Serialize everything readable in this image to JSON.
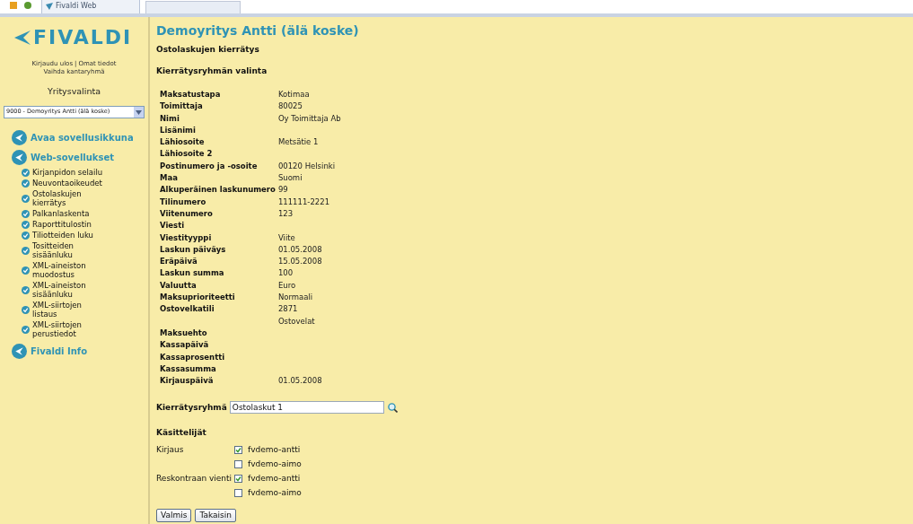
{
  "browser_tab": {
    "title": "Fivaldi Web"
  },
  "sidebar": {
    "logo": "FIVALDI",
    "links": [
      "Kirjaudu ulos",
      "Omat tiedot",
      "Vaihda kantaryhmä"
    ],
    "link_separator": "|",
    "company_label": "Yritysvalinta",
    "company_select": "9000 - Demoyritys Antti (älä koske)",
    "nav": [
      {
        "label": "Avaa sovellusikkuna"
      },
      {
        "label": "Web-sovellukset",
        "children": [
          "Kirjanpidon selailu",
          "Neuvontaoikeudet",
          "Ostolaskujen kierrätys",
          "Palkanlaskenta",
          "Raporttitulostin",
          "Tiliotteiden luku",
          "Tositteiden sisäänluku",
          "XML-aineiston muodostus",
          "XML-aineiston sisäänluku",
          "XML-siirtojen listaus",
          "XML-siirtojen perustiedot"
        ]
      },
      {
        "label": "Fivaldi Info"
      }
    ]
  },
  "main": {
    "title": "Demoyritys Antti (älä koske)",
    "subtitle": "Ostolaskujen kierrätys",
    "section": "Kierrätysryhmän valinta",
    "fields": [
      {
        "label": "Maksatustapa",
        "value": "Kotimaa"
      },
      {
        "label": "Toimittaja",
        "value": "80025"
      },
      {
        "label": "Nimi",
        "value": "Oy Toimittaja Ab"
      },
      {
        "label": "Lisänimi"
      },
      {
        "label": "Lähiosoite",
        "value": "Metsätie 1"
      },
      {
        "label": "Lähiosoite 2"
      },
      {
        "label": "Postinumero ja -osoite",
        "value": "00120 Helsinki"
      },
      {
        "label": "Maa",
        "value": "Suomi"
      },
      {
        "label": "Alkuperäinen laskunumero",
        "value": "99"
      },
      {
        "label": "Tilinumero",
        "value": "111111-2221"
      },
      {
        "label": "Viitenumero",
        "value": "123"
      },
      {
        "label": "Viesti"
      },
      {
        "label": "Viestityyppi",
        "value": "Viite"
      },
      {
        "label": "Laskun päiväys",
        "value": "01.05.2008"
      },
      {
        "label": "Eräpäivä",
        "value": "15.05.2008"
      },
      {
        "label": "Laskun summa",
        "value": "100"
      },
      {
        "label": "Valuutta",
        "value": "Euro"
      },
      {
        "label": "Maksuprioriteetti",
        "value": "Normaali"
      },
      {
        "label": "Ostovelkatili",
        "value": "2871"
      },
      {
        "value": "Ostovelat"
      },
      {
        "label": "Maksuehto"
      },
      {
        "label": "Kassapäivä"
      },
      {
        "label": "Kassaprosentti"
      },
      {
        "label": "Kassasumma"
      },
      {
        "label": "Kirjauspäivä",
        "value": "01.05.2008"
      }
    ],
    "group_label": "Kierrätysryhmä",
    "group_value": "Ostolaskut 1",
    "handlers_title": "Käsittelijät",
    "handlers": [
      {
        "label": "Kirjaus",
        "users": [
          {
            "name": "fvdemo-antti",
            "checked": true
          },
          {
            "name": "fvdemo-aimo",
            "checked": false
          }
        ]
      },
      {
        "label": "Reskontraan vienti",
        "users": [
          {
            "name": "fvdemo-antti",
            "checked": true
          },
          {
            "name": "fvdemo-aimo",
            "checked": false
          }
        ]
      }
    ],
    "buttons": [
      "Valmis",
      "Takaisin"
    ]
  }
}
